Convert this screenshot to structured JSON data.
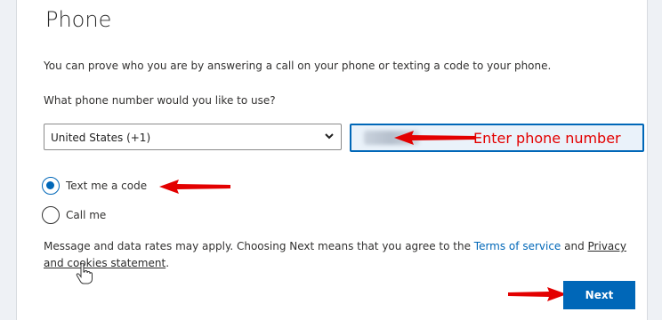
{
  "page": {
    "title": "Phone",
    "description": "You can prove who you are by answering a call on your phone or texting a code to your phone.",
    "question": "What phone number would you like to use?"
  },
  "country_select": {
    "value": "United States (+1)",
    "icon": "chevron-down-icon"
  },
  "phone_input": {
    "annotation": "Enter phone number"
  },
  "options": [
    {
      "label": "Text me a code",
      "checked": true
    },
    {
      "label": "Call me",
      "checked": false
    }
  ],
  "legal": {
    "prefix": "Message and data rates may apply. Choosing Next means that you agree to the ",
    "terms_link": "Terms of service",
    "and_text": " and ",
    "privacy_link_line1": "Privacy",
    "privacy_link_line2": "and cookies statement",
    "suffix": "."
  },
  "next_button": {
    "label": "Next"
  },
  "colors": {
    "accent": "#0067b8",
    "annotation": "#e30000"
  }
}
